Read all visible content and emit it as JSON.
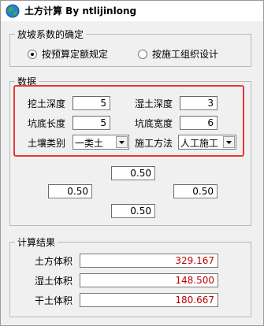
{
  "window": {
    "title": "土方计算 By ntlijinlong"
  },
  "slope_group": {
    "legend": "放坡系数的确定",
    "options": [
      {
        "label": "按预算定额规定",
        "checked": true
      },
      {
        "label": "按施工组织设计",
        "checked": false
      }
    ]
  },
  "data_group": {
    "legend": "数据",
    "fields": {
      "dig_depth": {
        "label": "挖土深度",
        "value": "5"
      },
      "wet_depth": {
        "label": "湿土深度",
        "value": "3"
      },
      "pit_length": {
        "label": "坑底长度",
        "value": "5"
      },
      "pit_width": {
        "label": "坑底宽度",
        "value": "6"
      }
    },
    "soil_type": {
      "label": "土壤类别",
      "value": "一类土"
    },
    "method": {
      "label": "施工方法",
      "value": "人工施工"
    },
    "slope_values": {
      "top": "0.50",
      "left": "0.50",
      "right": "0.50",
      "bottom": "0.50"
    }
  },
  "results": {
    "legend": "计算结果",
    "earth_volume": {
      "label": "土方体积",
      "value": "329.167"
    },
    "wet_volume": {
      "label": "湿土体积",
      "value": "148.500"
    },
    "dry_volume": {
      "label": "干土体积",
      "value": "180.667"
    }
  },
  "colors": {
    "result_text": "#c00000",
    "highlight": "#e53935"
  }
}
